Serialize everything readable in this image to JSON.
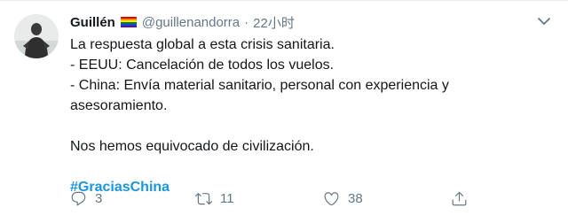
{
  "tweet": {
    "author_name": "Guillén",
    "handle": "@guillenandorra",
    "separator": "·",
    "time": "22小时",
    "lines": [
      "La respuesta global a esta crisis sanitaria.",
      "- EEUU: Cancelación de todos los vuelos.",
      "- China: Envía material sanitario, personal con experiencia y asesoramiento."
    ],
    "closing": "Nos hemos equivocado de civilización.",
    "hashtag": "#GraciasChina"
  },
  "actions": {
    "reply_count": "3",
    "retweet_count": "11",
    "like_count": "38"
  },
  "icons": {
    "avatar": "avatar",
    "flag": "rainbow-flag-icon",
    "caret": "chevron-down-icon",
    "reply": "reply-icon",
    "retweet": "retweet-icon",
    "like": "heart-icon",
    "share": "share-icon"
  },
  "colors": {
    "link": "#1b95e0",
    "secondary": "#657786",
    "text": "#14171a"
  }
}
